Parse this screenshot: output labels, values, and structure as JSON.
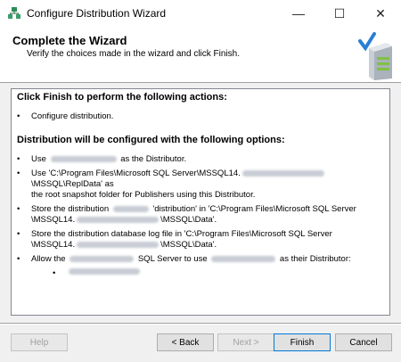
{
  "window": {
    "title": "Configure Distribution Wizard",
    "minimize_glyph": "—",
    "maximize_glyph": "☐",
    "close_glyph": "✕"
  },
  "header": {
    "title": "Complete the Wizard",
    "subtitle": "Verify the choices made in the wizard and click Finish."
  },
  "report": {
    "heading_actions": "Click Finish to perform the following actions:",
    "actions": [
      {
        "bullet": "•",
        "text": "Configure distribution."
      }
    ],
    "heading_options": "Distribution will be configured with the following options:",
    "options": {
      "distributor_pre": "Use",
      "distributor_post": "as the Distributor.",
      "snapshot_line1_pre": "Use 'C:\\Program Files\\Microsoft SQL Server\\MSSQL14.",
      "snapshot_line1_post": "\\MSSQL\\ReplData' as",
      "snapshot_line2": "the root snapshot folder for Publishers using this Distributor.",
      "db_line1_pre": "Store the distribution",
      "db_line1_post": "'distribution' in 'C:\\Program Files\\Microsoft SQL Server",
      "db_line2_pre": "\\MSSQL14.",
      "db_line2_post": "\\MSSQL\\Data'.",
      "log_line1": "Store the distribution database log file in 'C:\\Program Files\\Microsoft SQL Server",
      "log_line2_pre": "\\MSSQL14.",
      "log_line2_post": "\\MSSQL\\Data'.",
      "allow_pre": "Allow the",
      "allow_mid": "SQL Server to use",
      "allow_post": "as their Distributor:",
      "bullet": "•"
    }
  },
  "buttons": {
    "help": "Help",
    "back": "< Back",
    "next": "Next >",
    "finish": "Finish",
    "cancel": "Cancel"
  },
  "colors": {
    "accent": "#0078d7",
    "background": "#f0f0f0"
  }
}
